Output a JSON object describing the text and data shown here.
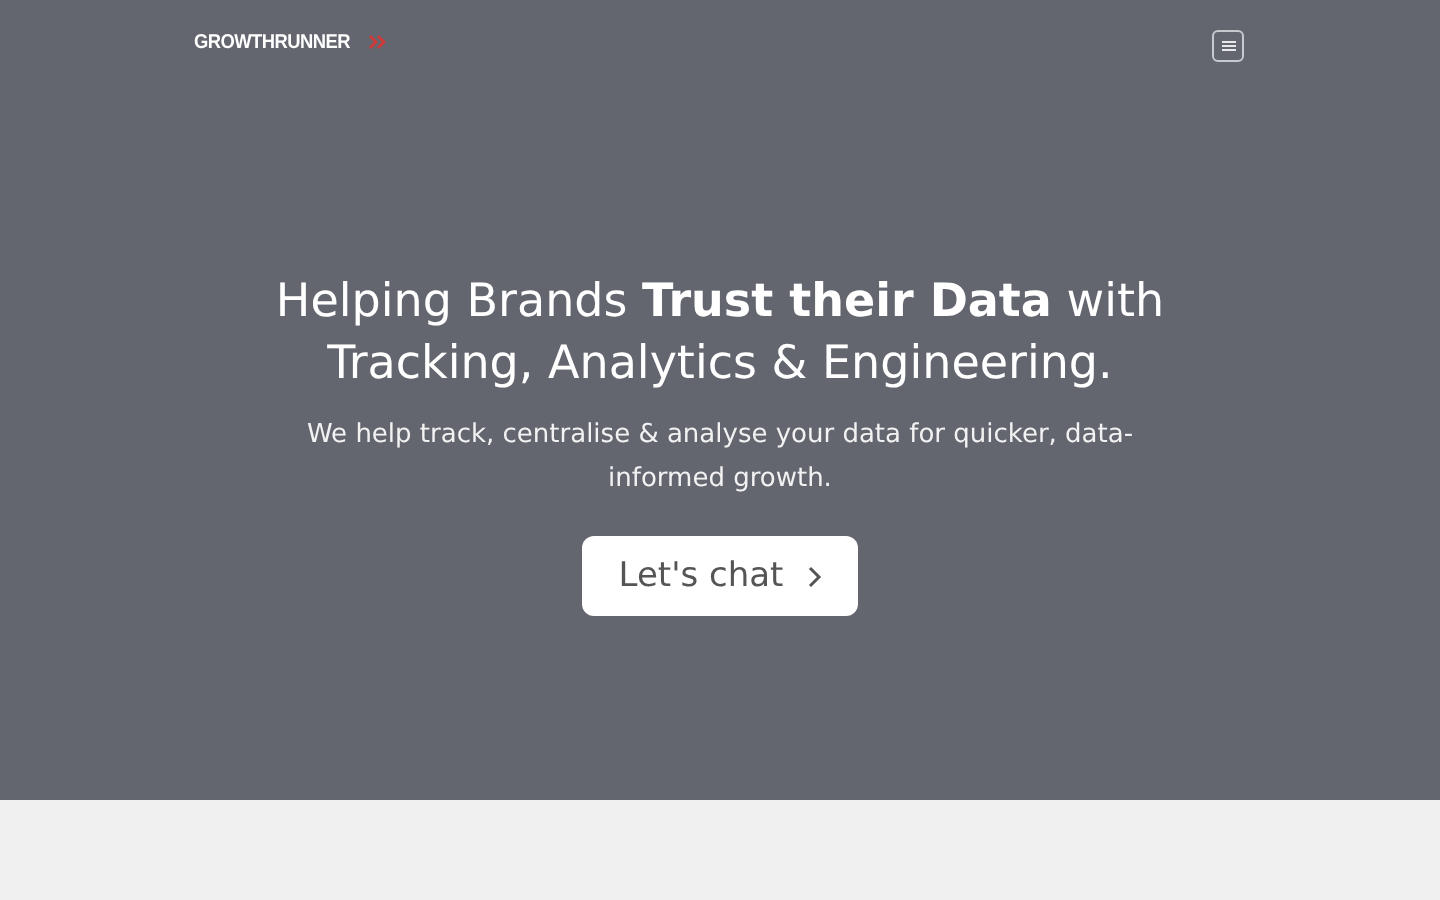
{
  "header": {
    "logo": "GROWTHRUNNER"
  },
  "hero": {
    "headline": "Helping Brands **Trust their Data** with Tracking, Analytics & Engineering.",
    "subtitle": "We help track, centralise & analyse your data for quicker, data-informed growth.",
    "cta": "Let's chat"
  }
}
